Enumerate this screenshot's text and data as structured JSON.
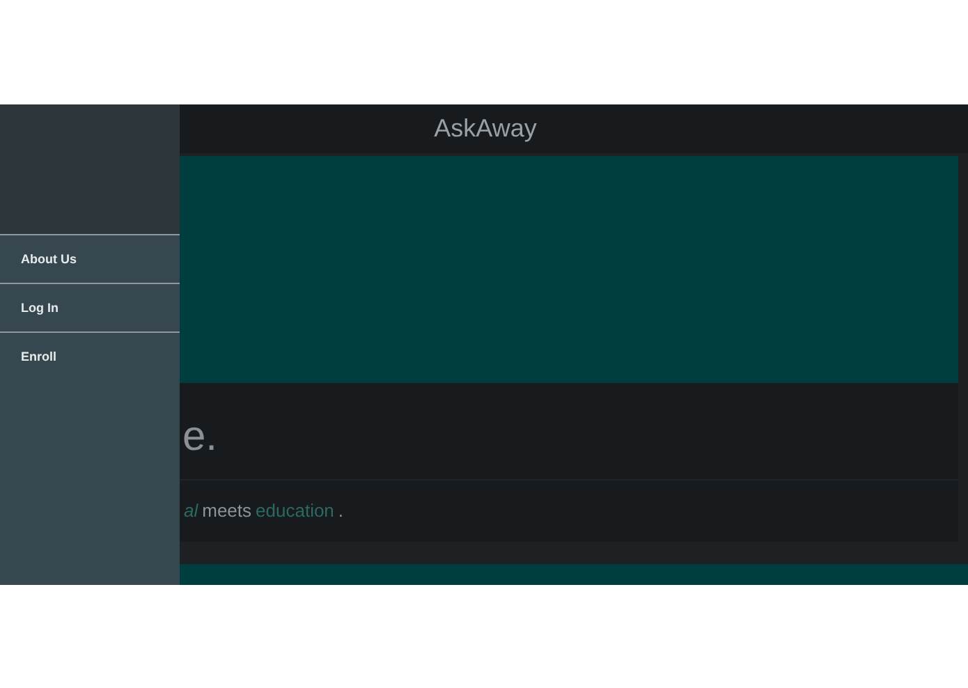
{
  "header": {
    "title": "AskAway"
  },
  "drawer": {
    "items": [
      {
        "label": "About Us"
      },
      {
        "label": "Log In"
      },
      {
        "label": "Enroll"
      }
    ]
  },
  "intro": {
    "heading": "e.",
    "tagline": [
      {
        "text": "al",
        "kind": "accent"
      },
      {
        "text": "meets",
        "kind": "plain"
      },
      {
        "text": "education",
        "kind": "accent"
      },
      {
        "text": ".",
        "kind": "plain"
      }
    ]
  }
}
